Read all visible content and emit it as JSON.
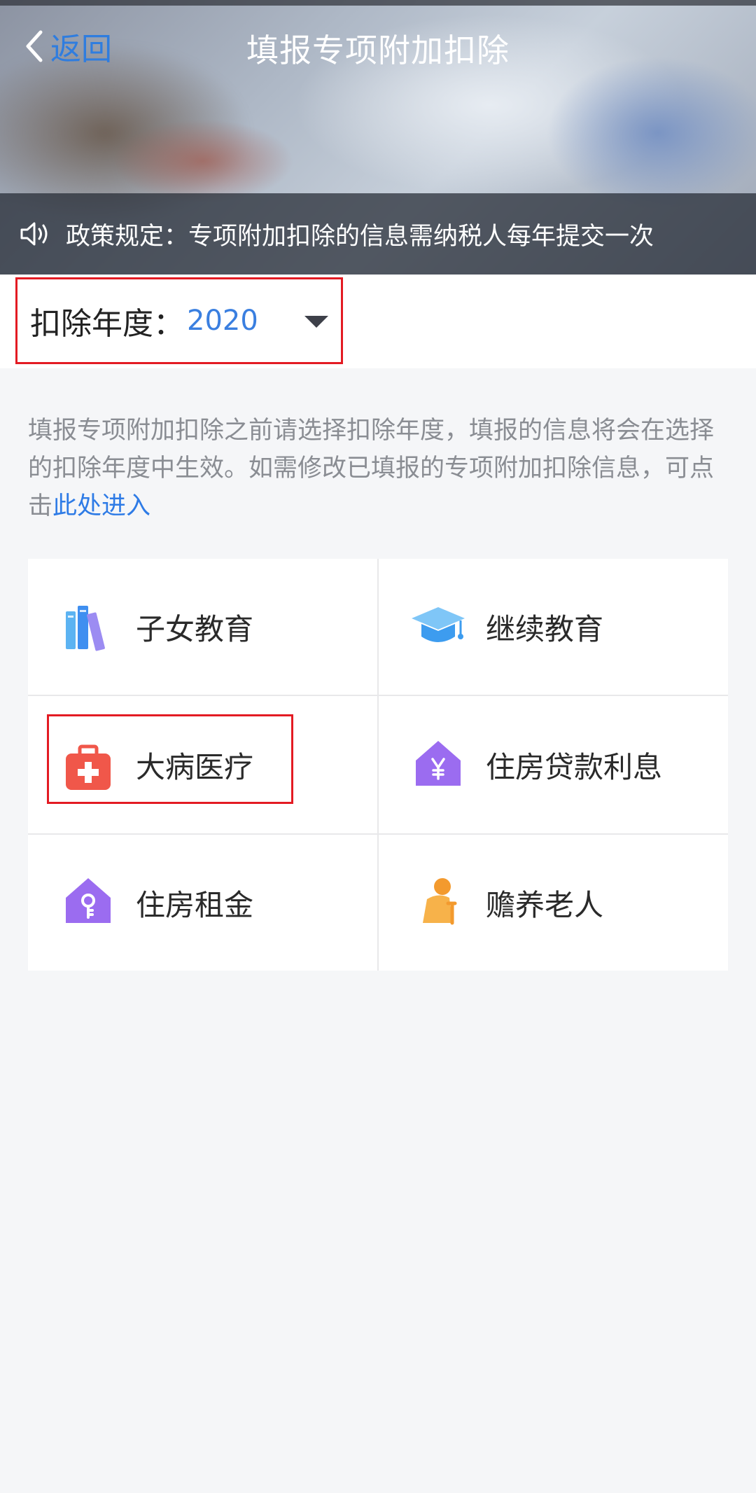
{
  "header": {
    "back_label": "返回",
    "title": "填报专项附加扣除"
  },
  "notice": {
    "text": "政策规定：专项附加扣除的信息需纳税人每年提交一次"
  },
  "year_selector": {
    "label": "扣除年度：",
    "value": "2020"
  },
  "hint": {
    "text": "填报专项附加扣除之前请选择扣除年度，填报的信息将会在选择的扣除年度中生效。如需修改已填报的专项附加扣除信息，可点击",
    "link_text": "此处进入"
  },
  "categories": [
    {
      "label": "子女教育",
      "icon": "books-icon"
    },
    {
      "label": "继续教育",
      "icon": "graduation-cap-icon"
    },
    {
      "label": "大病医疗",
      "icon": "medical-kit-icon"
    },
    {
      "label": "住房贷款利息",
      "icon": "house-yen-icon"
    },
    {
      "label": "住房租金",
      "icon": "house-key-icon"
    },
    {
      "label": "赡养老人",
      "icon": "elderly-person-icon"
    }
  ],
  "colors": {
    "accent": "#2e7be6",
    "highlight_border": "#e31b23",
    "medical": "#f0574a",
    "house": "#9b6cf0",
    "elderly": "#f5a53a",
    "books": "#4ea6ee",
    "cap": "#5ab7f0"
  }
}
